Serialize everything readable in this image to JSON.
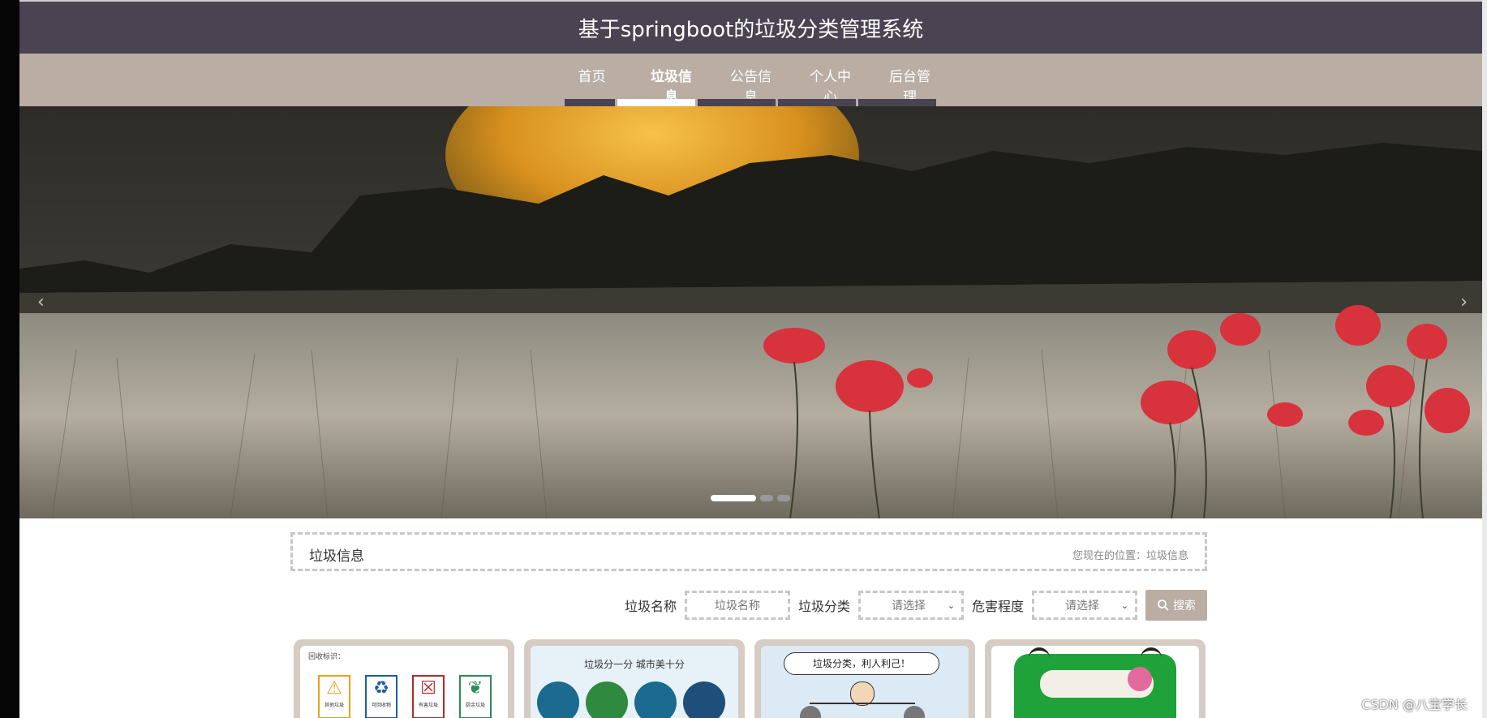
{
  "site": {
    "title": "基于springboot的垃圾分类管理系统"
  },
  "nav": {
    "items": [
      {
        "label": "首页"
      },
      {
        "label": "垃圾信息"
      },
      {
        "label": "公告信息"
      },
      {
        "label": "个人中心"
      },
      {
        "label": "后台管理"
      }
    ],
    "active_index": 1
  },
  "banner": {
    "slide_count": 3,
    "active_slide": 1
  },
  "breadcrumb": {
    "title": "垃圾信息",
    "location": "您现在的位置：垃圾信息"
  },
  "search": {
    "name_label": "垃圾名称",
    "name_placeholder": "垃圾名称",
    "category_label": "垃圾分类",
    "category_value": "请选择",
    "hazard_label": "危害程度",
    "hazard_value": "请选择",
    "button_label": "搜索"
  },
  "cards": [
    {
      "heading": "回收标识：",
      "sign_labels": [
        "其他垃圾",
        "可回收物",
        "有害垃圾",
        "厨余垃圾"
      ],
      "sign_colors": [
        "#e8a21a",
        "#1f5aa6",
        "#b22a2a",
        "#2d8a5a"
      ]
    },
    {
      "slogan": "垃圾分一分 城市美十分"
    },
    {
      "slogan": "垃圾分类，利人利己！"
    },
    {
      "accent": "#1fa23a"
    }
  ],
  "watermark": "CSDN @八宝学长"
}
